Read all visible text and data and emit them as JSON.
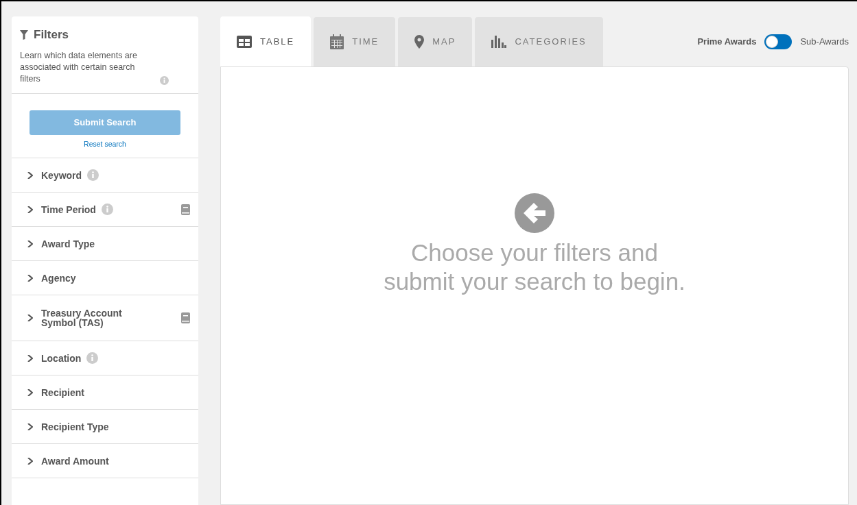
{
  "sidebar": {
    "title": "Filters",
    "description": "Learn which data elements are associated with certain search filters",
    "submit": {
      "label": "Submit Search",
      "disabled": true
    },
    "reset": "Reset search",
    "items": [
      {
        "label": "Keyword",
        "info": true,
        "guide": false,
        "expanded": false
      },
      {
        "label": "Time Period",
        "info": true,
        "guide": true,
        "expanded": false
      },
      {
        "label": "Award Type",
        "info": false,
        "guide": false,
        "expanded": false
      },
      {
        "label": "Agency",
        "info": false,
        "guide": false,
        "expanded": false
      },
      {
        "label": "Treasury Account Symbol (TAS)",
        "info": false,
        "guide": true,
        "expanded": false
      },
      {
        "label": "Location",
        "info": true,
        "guide": false,
        "expanded": false
      },
      {
        "label": "Recipient",
        "info": false,
        "guide": false,
        "expanded": false
      },
      {
        "label": "Recipient Type",
        "info": false,
        "guide": false,
        "expanded": false
      },
      {
        "label": "Award Amount",
        "info": false,
        "guide": false,
        "expanded": false
      }
    ]
  },
  "tabs": [
    {
      "label": "TABLE",
      "kind": "table",
      "selected": true
    },
    {
      "label": "TIME",
      "kind": "time",
      "selected": false
    },
    {
      "label": "MAP",
      "kind": "map",
      "selected": false
    },
    {
      "label": "CATEGORIES",
      "kind": "categories",
      "selected": false
    }
  ],
  "award_toggle": {
    "options": [
      {
        "label": "Prime Awards",
        "selected": true
      },
      {
        "label": "Sub-Awards",
        "selected": false
      }
    ]
  },
  "empty_state": {
    "message": "Choose your filters and submit your search to begin."
  }
}
